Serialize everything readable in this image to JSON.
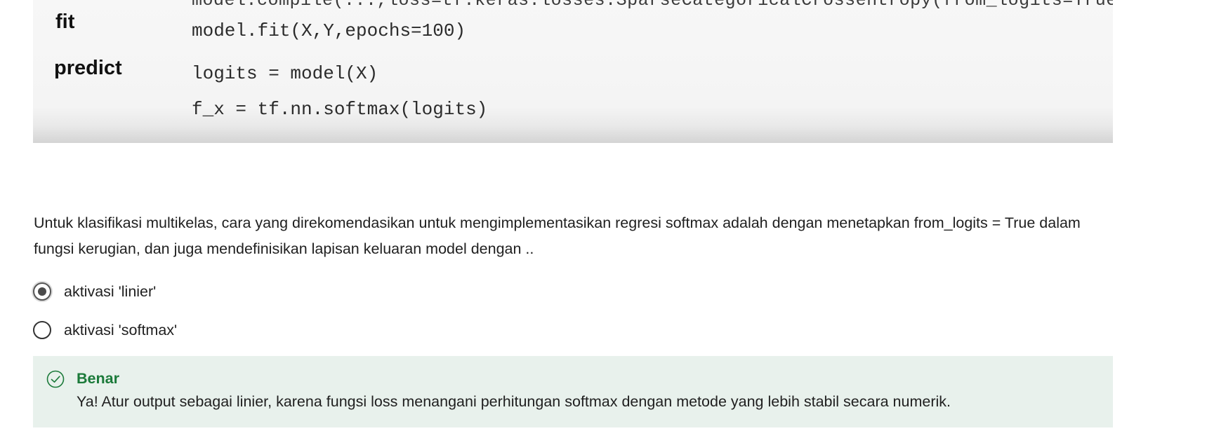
{
  "code_image": {
    "cut_line": "model.compile(...,loss=tf.keras.losses.SparseCategoricalCrossentropy(from_logits=True))",
    "rows": [
      {
        "label": "fit",
        "lines": [
          "model.fit(X,Y,epochs=100)"
        ]
      },
      {
        "label": "predict",
        "lines": [
          "logits = model(X)",
          "f_x = tf.nn.softmax(logits)"
        ]
      }
    ]
  },
  "question": {
    "text": "Untuk klasifikasi multikelas, cara yang direkomendasikan untuk mengimplementasikan regresi softmax adalah dengan menetapkan from_logits = True dalam fungsi kerugian, dan juga mendefinisikan lapisan keluaran model dengan .."
  },
  "options": [
    {
      "label": "aktivasi 'linier'",
      "selected": true
    },
    {
      "label": "aktivasi 'softmax'",
      "selected": false
    }
  ],
  "feedback": {
    "title": "Benar",
    "message": "Ya! Atur output sebagai linier, karena fungsi loss menangani perhitungan softmax dengan metode yang lebih stabil secara numerik.",
    "icon": "check-circle-icon",
    "accent_color": "#1b7a3a",
    "background_color": "#e8f1ec"
  }
}
